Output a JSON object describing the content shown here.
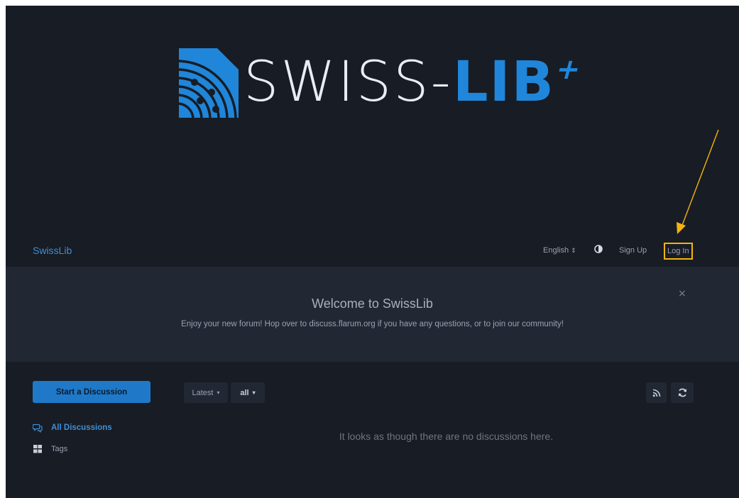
{
  "logo": {
    "word_light": "SWISS-",
    "word_bold": "LIB",
    "plus": "+",
    "colors": {
      "light": "#e9edf3",
      "accent": "#1f86da"
    }
  },
  "header": {
    "brand": "SwissLib",
    "language": "English",
    "language_caret": "⇕",
    "theme_icon": "half-circle-icon",
    "signup": "Sign Up",
    "login": "Log In"
  },
  "welcome": {
    "title": "Welcome to SwissLib",
    "body": "Enjoy your new forum! Hop over to discuss.flarum.org if you have any questions, or to join our community!",
    "close": "×"
  },
  "sidebar": {
    "start_button": "Start a Discussion",
    "nav": [
      {
        "label": "All Discussions",
        "icon": "chat-bubbles-icon"
      },
      {
        "label": "Tags",
        "icon": "grid-icon"
      }
    ]
  },
  "toolbar": {
    "sort": "Latest",
    "filter": "all",
    "caret": "▾"
  },
  "main": {
    "empty_message": "It looks as though there are no discussions here."
  },
  "colors": {
    "background": "#181c24",
    "panel": "#222833",
    "primary": "#1f79c8",
    "link": "#3d8fd6",
    "highlight": "#f3b40e"
  }
}
